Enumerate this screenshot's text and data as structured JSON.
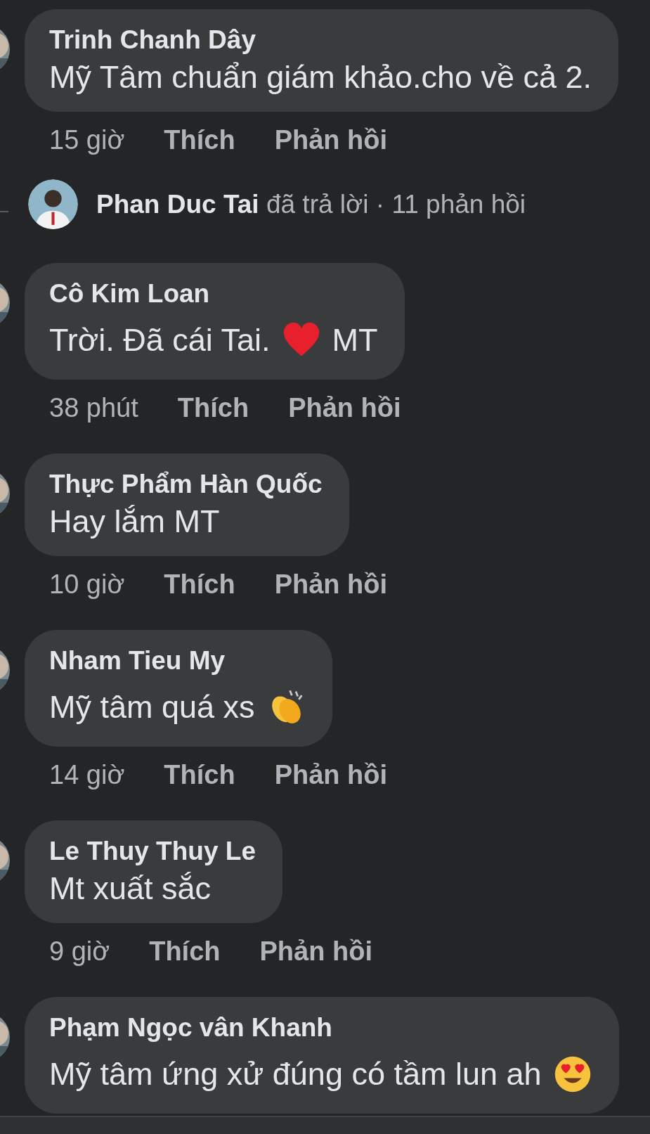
{
  "comments": [
    {
      "author": "Trinh Chanh Dây",
      "body": "Mỹ Tâm chuẩn giám khảo.cho về cả 2.",
      "time": "15 giờ",
      "like": "Thích",
      "reply": "Phản hồi",
      "replies_summary": "**Phan Duc Tai** đã trả lời · 11 phản hồi"
    },
    {
      "author": "Cô Kim Loan",
      "body": "Trời. Đã cái Tai.",
      "emoji": {
        "kind": "heart"
      },
      "body_after": "MT",
      "time": "38 phút",
      "like": "Thích",
      "reply": "Phản hồi"
    },
    {
      "author": "Thực Phẩm Hàn Quốc",
      "body": "Hay lắm MT",
      "time": "10 giờ",
      "like": "Thích",
      "reply": "Phản hồi"
    },
    {
      "author": "Nham Tieu My",
      "body": "Mỹ tâm quá xs",
      "emoji": {
        "kind": "clap"
      },
      "time": "14 giờ",
      "like": "Thích",
      "reply": "Phản hồi"
    },
    {
      "author": "Le Thuy Thuy Le",
      "body": "Mt xuất sắc",
      "time": "9 giờ",
      "like": "Thích",
      "reply": "Phản hồi"
    },
    {
      "author": "Phạm Ngọc vân Khanh",
      "body": "Mỹ tâm ứng xử đúng có tầm lun ah",
      "emoji": {
        "kind": "heart_eyes"
      }
    }
  ]
}
